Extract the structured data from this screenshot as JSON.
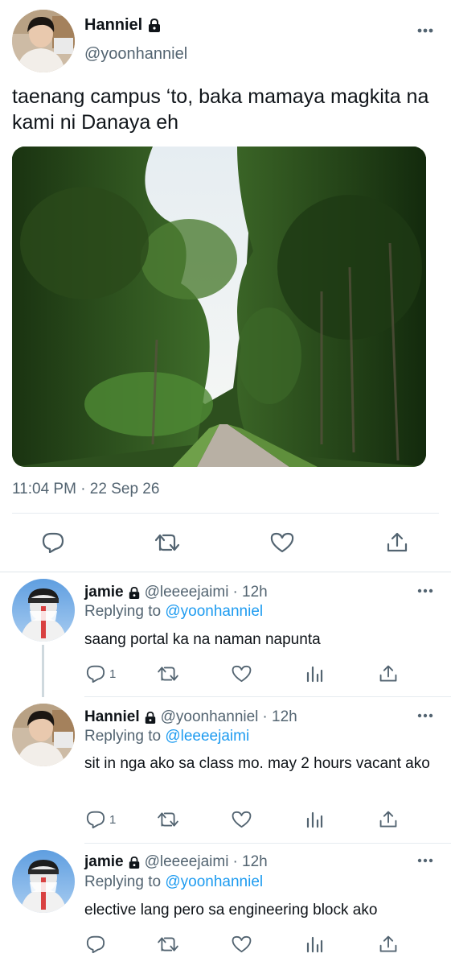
{
  "main_tweet": {
    "display_name": "Hanniel",
    "handle": "@yoonhanniel",
    "text": "taenang campus ‘to, baka mamaya magkita na kami ni Danaya eh",
    "photo_alt": "tree-lined road",
    "timestamp": "11:04 PM · 22 Sep 26",
    "actions": [
      {
        "icon": "reply-icon"
      },
      {
        "icon": "retweet-icon"
      },
      {
        "icon": "like-icon"
      },
      {
        "icon": "share-icon"
      }
    ]
  },
  "replies": [
    {
      "display_name": "jamie",
      "handle": "@leeeejaimi",
      "time": "· 12h",
      "replying_prefix": "Replying to ",
      "replying_to": "@yoonhanniel",
      "text": "saang portal ka na naman napunta",
      "reply_count": "1",
      "avatar": "jamie"
    },
    {
      "display_name": "Hanniel",
      "handle": "@yoonhanniel",
      "time": "· 12h",
      "replying_prefix": "Replying to ",
      "replying_to": "@leeeejaimi",
      "text": "sit in nga ako sa class mo. may 2 hours vacant ako",
      "reply_count": "1",
      "avatar": "hanniel"
    },
    {
      "display_name": "jamie",
      "handle": "@leeeejaimi",
      "time": "· 12h",
      "replying_prefix": "Replying to ",
      "replying_to": "@yoonhanniel",
      "text": "elective lang pero sa engineering block ako",
      "reply_count": "",
      "avatar": "jamie"
    }
  ],
  "colors": {
    "text": "#0f1419",
    "secondary": "#536471",
    "accent": "#1d9bf0",
    "divider": "#e6ecf0"
  }
}
